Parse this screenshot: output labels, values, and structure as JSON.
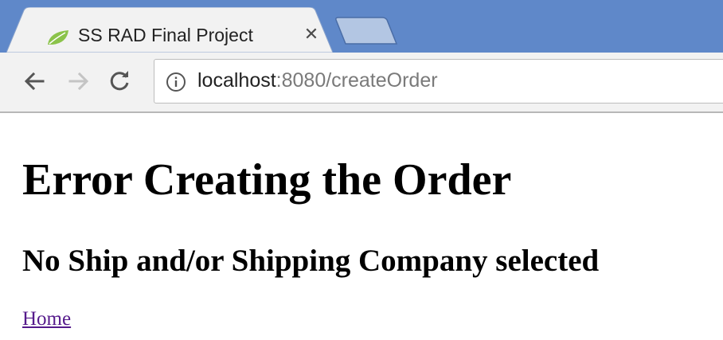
{
  "browser": {
    "tab": {
      "title": "SS RAD Final Project",
      "close_glyph": "✕",
      "favicon": "spring-leaf-icon"
    },
    "address_bar": {
      "host": "localhost",
      "rest": ":8080/createOrder",
      "info_icon": "info-icon"
    },
    "nav": {
      "back": "back-arrow-icon",
      "forward": "forward-arrow-icon",
      "reload": "reload-icon"
    },
    "colors": {
      "tabstrip": "#5f88c9",
      "toolbar": "#f2f2f2",
      "visited_link": "#551a8b"
    }
  },
  "page": {
    "heading": "Error Creating the Order",
    "subheading": "No Ship and/or Shipping Company selected",
    "home_link": "Home"
  }
}
